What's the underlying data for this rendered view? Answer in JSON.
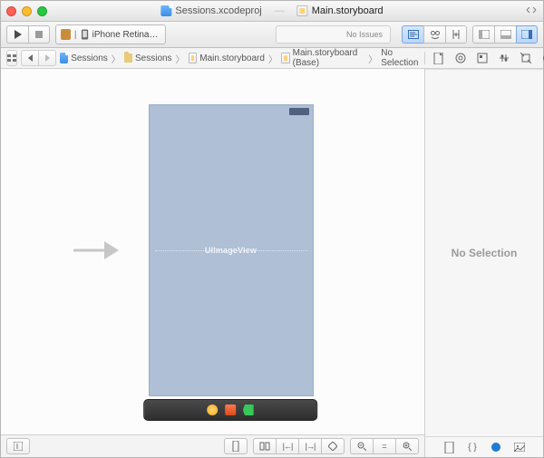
{
  "tabs": [
    {
      "label": "Sessions.xcodeproj"
    },
    {
      "label": "Main.storyboard"
    }
  ],
  "toolbar": {
    "scheme": "iPhone Retina (3...",
    "status": "No Issues"
  },
  "breadcrumb": [
    "Sessions",
    "Sessions",
    "Main.storyboard",
    "Main.storyboard (Base)",
    "No Selection"
  ],
  "canvas": {
    "placeholder": "UIImageView"
  },
  "utilities": {
    "body": "No Selection"
  }
}
